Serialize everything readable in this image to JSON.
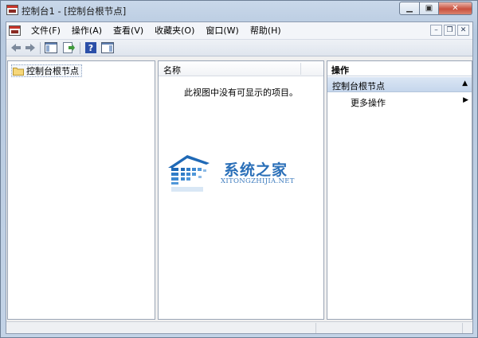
{
  "window": {
    "title": "控制台1 - [控制台根节点]",
    "caption_buttons": [
      "minimize",
      "maximize",
      "close"
    ]
  },
  "menubar": {
    "items": [
      "文件(F)",
      "操作(A)",
      "查看(V)",
      "收藏夹(O)",
      "窗口(W)",
      "帮助(H)"
    ]
  },
  "tree": {
    "root_label": "控制台根节点"
  },
  "list": {
    "column_header": "名称",
    "empty_message": "此视图中没有可显示的项目。"
  },
  "actions": {
    "title": "操作",
    "section_label": "控制台根节点",
    "more_label": "更多操作"
  },
  "watermark": {
    "cn": "系统之家",
    "en": "XITONGZHIJIA.NET"
  },
  "colors": {
    "accent": "#2a6fb8",
    "close_button": "#c9513e"
  }
}
